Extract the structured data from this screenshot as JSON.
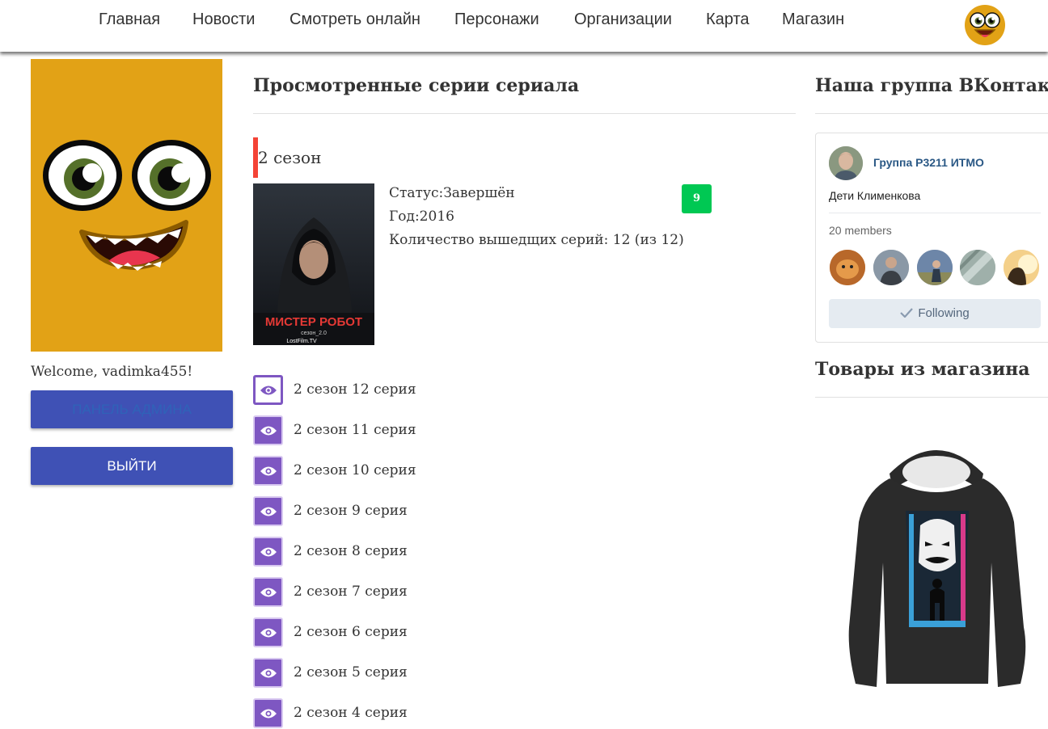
{
  "nav": {
    "items": [
      "Главная",
      "Новости",
      "Смотреть онлайн",
      "Персонажи",
      "Организации",
      "Карта",
      "Магазин"
    ],
    "logo_icon": "smiley-face-logo-icon"
  },
  "sidebar": {
    "welcome": "Welcome, vadimka455!",
    "admin_button": "ПАНЕЛЬ АДМИНА",
    "logout_button": "ВЫЙТИ"
  },
  "main": {
    "title": "Просмотренные серии сериала",
    "season": {
      "title": "2 сезон",
      "poster_text": "МИСТЕР РОБОТ",
      "poster_small": "сезон_2.0",
      "poster_studio": "LostFilm.TV",
      "status": "Статус:Завершён",
      "year": "Год:2016",
      "episodes_count": "Количество вышедщих серий: 12 (из 12)",
      "score": "9"
    },
    "episodes": [
      "2 сезон 12 серия",
      "2 сезон 11 серия",
      "2 сезон 10 серия",
      "2 сезон 9 серия",
      "2 сезон 8 серия",
      "2 сезон 7 серия",
      "2 сезон 6 серия",
      "2 сезон 5 серия",
      "2 сезон 4 серия"
    ]
  },
  "right": {
    "vk_title": "Наша группа ВКонтакте",
    "vk_group_name": "Группа Р3211 ИТМО",
    "vk_group_desc": "Дети Клименкова",
    "vk_members": "20 members",
    "vk_follow": "Following",
    "shop_title": "Товары из магазина"
  },
  "colors": {
    "accent": "#3f51b5",
    "season_bar": "#f44336",
    "score_badge": "#00c853",
    "eye_button": "#7e57c2",
    "avatar_bg": "#e2a216"
  }
}
